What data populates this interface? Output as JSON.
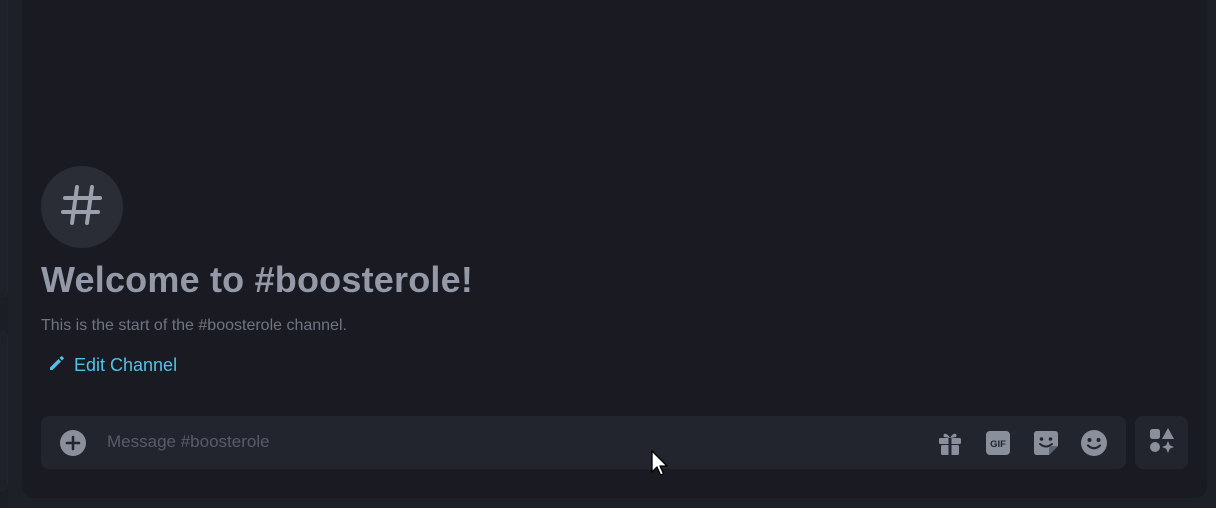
{
  "channel": {
    "icon": "hash-icon",
    "welcome_title": "Welcome to #boosterole!",
    "welcome_subtitle": "This is the start of the #boosterole channel.",
    "edit_label": "Edit Channel"
  },
  "composer": {
    "placeholder": "Message #boosterole",
    "value": "",
    "gif_label": "GIF",
    "icons": [
      "plus-circle-icon",
      "gift-icon",
      "gif-icon",
      "sticker-icon",
      "emoji-icon",
      "apps-icon"
    ]
  },
  "colors": {
    "background": "#1a1b22",
    "accent": "#4fc3e8",
    "title": "#9499a8",
    "muted": "#6f7482",
    "input_bg": "#22252d",
    "icon": "#8a8f9c"
  }
}
